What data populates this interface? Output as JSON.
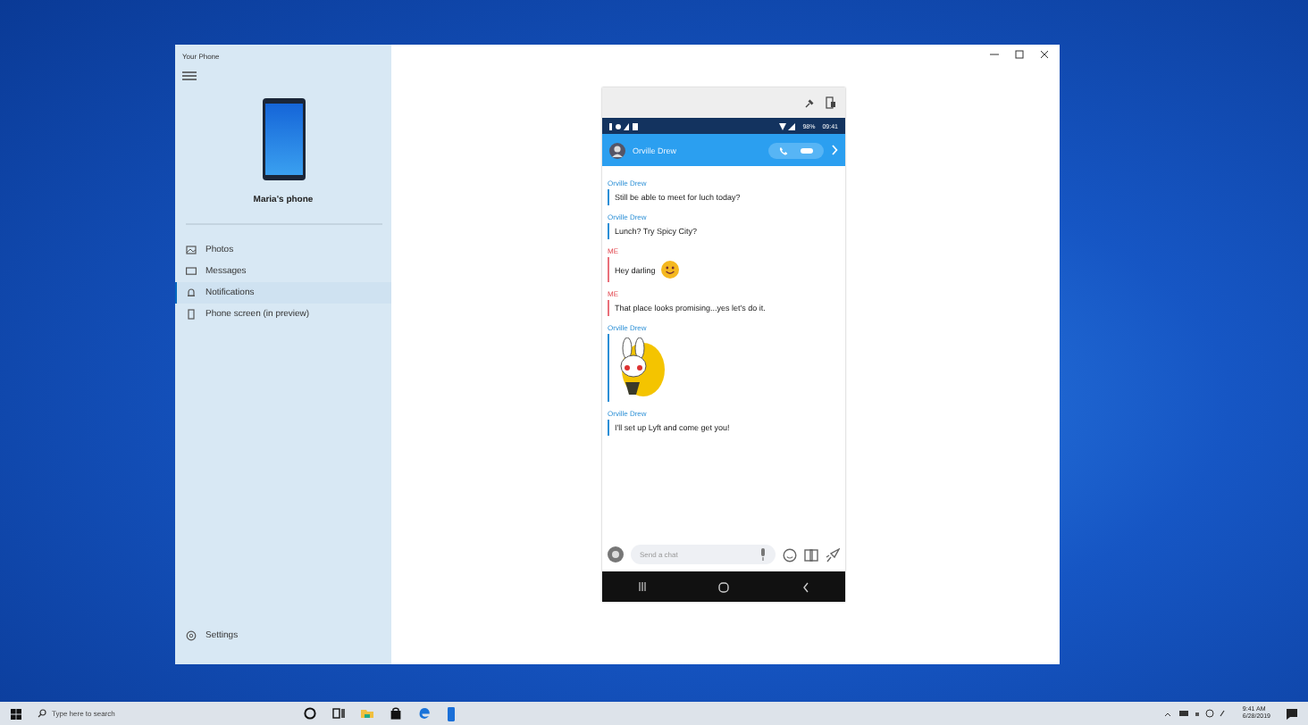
{
  "window": {
    "title": "Your Phone"
  },
  "sidebar": {
    "device_name": "Maria's phone",
    "items": [
      {
        "label": "Photos",
        "kind": "photos",
        "selected": false
      },
      {
        "label": "Messages",
        "kind": "messages",
        "selected": false
      },
      {
        "label": "Notifications",
        "kind": "notifications",
        "selected": true
      },
      {
        "label": "Phone screen (in preview)",
        "kind": "screen",
        "selected": false
      }
    ],
    "settings": "Settings"
  },
  "phone": {
    "status": {
      "battery": "98%",
      "time": "09:41"
    },
    "contact": "Orville Drew",
    "messages": [
      {
        "sender": "Orville Drew",
        "from_me": false,
        "kind": "text",
        "text": "Still be able to meet for luch today?"
      },
      {
        "sender": "Orville Drew",
        "from_me": false,
        "kind": "text",
        "text": "Lunch? Try Spicy City?"
      },
      {
        "sender": "ME",
        "from_me": true,
        "kind": "text_emoji",
        "text": "Hey darling"
      },
      {
        "sender": "ME",
        "from_me": true,
        "kind": "text",
        "text": "That place looks promising...yes let's do it."
      },
      {
        "sender": "Orville Drew",
        "from_me": false,
        "kind": "sticker"
      },
      {
        "sender": "Orville Drew",
        "from_me": false,
        "kind": "text",
        "text": "I'll set up Lyft and come get you!"
      }
    ],
    "composer": {
      "placeholder": "Send a chat"
    }
  },
  "taskbar": {
    "search_placeholder": "Type here to search",
    "time": "9:41 AM",
    "date": "6/28/2019"
  }
}
